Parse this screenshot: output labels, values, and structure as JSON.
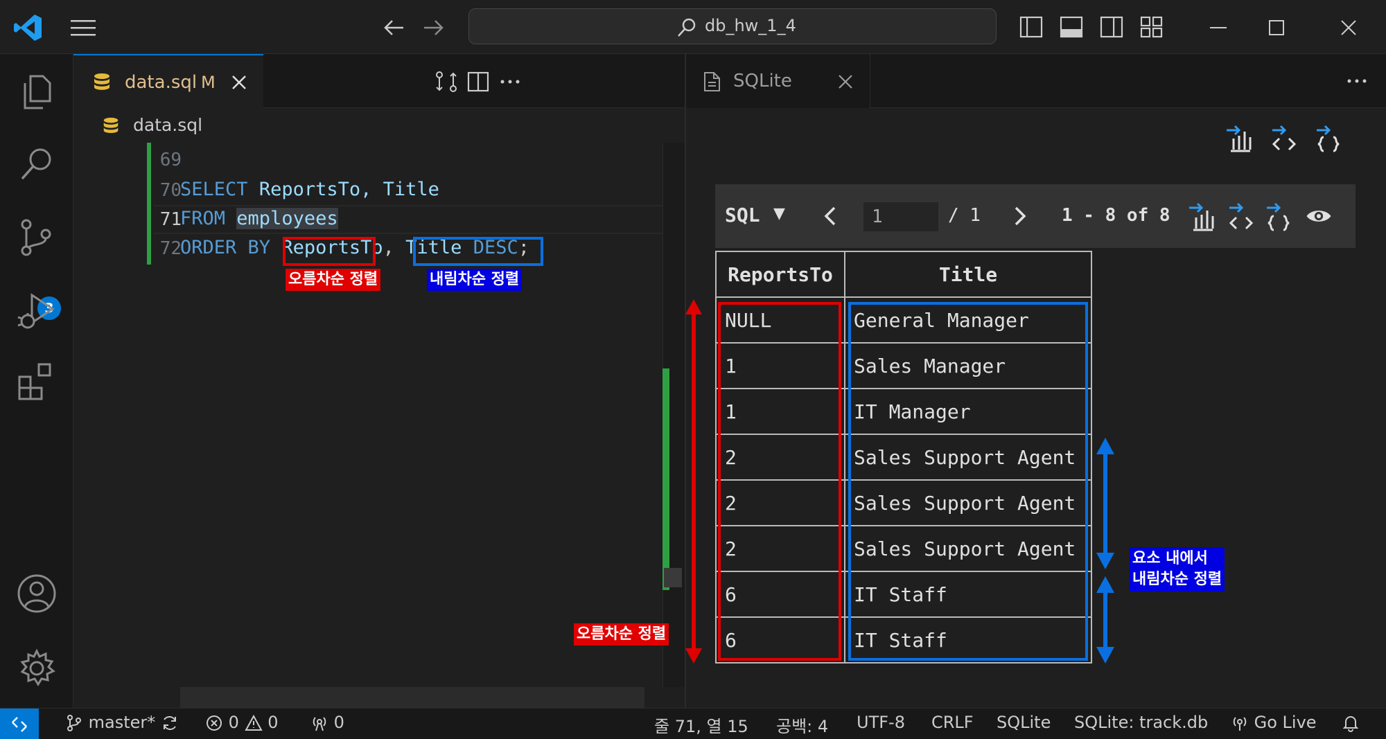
{
  "window": {
    "search_label": "db_hw_1_4"
  },
  "activity": {
    "scm_badge": "3"
  },
  "editor": {
    "tab_name": "data.sql",
    "tab_status": "M",
    "breadcrumb": "data.sql",
    "line_numbers": [
      "69",
      "70",
      "71",
      "72"
    ],
    "code": {
      "line70_kw": "SELECT",
      "line70_rest": "ReportsTo, Title",
      "line71_kw": "FROM",
      "line71_ident": "employees",
      "line72_kw": "ORDER BY",
      "line72_col1": "ReportsTo",
      "line72_comma": ",",
      "line72_col2": "Title",
      "line72_desc": "DESC",
      "line72_end": ";"
    },
    "annotation_asc": "오름차순 정렬",
    "annotation_desc": "내림차순 정렬"
  },
  "sqlite_panel": {
    "tab_name": "SQLite",
    "toolbar": {
      "mode": "SQL",
      "caret": "▼",
      "page_value": "1",
      "page_total": "/ 1",
      "range": "1 - 8 of 8"
    },
    "table": {
      "headers": [
        "ReportsTo",
        "Title"
      ],
      "rows": [
        [
          "NULL",
          "General Manager"
        ],
        [
          "1",
          "Sales Manager"
        ],
        [
          "1",
          "IT Manager"
        ],
        [
          "2",
          "Sales Support Agent"
        ],
        [
          "2",
          "Sales Support Agent"
        ],
        [
          "2",
          "Sales Support Agent"
        ],
        [
          "6",
          "IT Staff"
        ],
        [
          "6",
          "IT Staff"
        ]
      ]
    },
    "annotation_asc": "오름차순 정렬",
    "annotation_desc_line1": "요소 내에서",
    "annotation_desc_line2": "내림차순 정렬"
  },
  "statusbar": {
    "branch": "master*",
    "errors": "0",
    "warnings": "0",
    "ports": "0",
    "position": "줄 71, 열 15",
    "spaces": "공백: 4",
    "encoding": "UTF-8",
    "eol": "CRLF",
    "language": "SQLite",
    "db": "SQLite: track.db",
    "go_live": "Go Live"
  },
  "colors": {
    "accent": "#0078d4",
    "annotation_red": "#e00000",
    "annotation_blue": "#0a6fe0",
    "keyword": "#569cd6",
    "identifier": "#9cdcfe",
    "modified": "#e2c08d"
  }
}
